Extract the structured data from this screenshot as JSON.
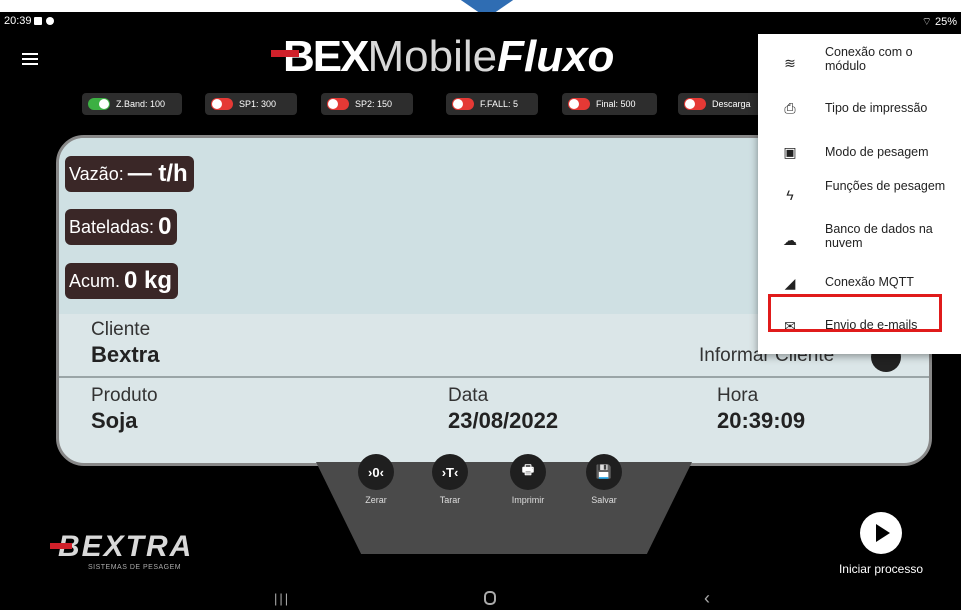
{
  "status_bar": {
    "time": "20:39",
    "battery": "25%"
  },
  "header": {
    "brand_bex": "BEX",
    "brand_mobile": "Mobile",
    "brand_fluxo": "Fluxo"
  },
  "pills": [
    {
      "label": "Z.Band: 100",
      "state": "on"
    },
    {
      "label": "SP1: 300",
      "state": "off"
    },
    {
      "label": "SP2: 150",
      "state": "off"
    },
    {
      "label": "F.FALL: 5",
      "state": "off"
    },
    {
      "label": "Final: 500",
      "state": "off"
    },
    {
      "label": "Descarga",
      "state": "off"
    }
  ],
  "stats": {
    "vazao_label": "Vazão:",
    "vazao_value": "— t/h",
    "bateladas_label": "Bateladas:",
    "bateladas_value": "0",
    "acum_label": "Acum.",
    "acum_value": "0 kg"
  },
  "info": {
    "cliente_label": "Cliente",
    "cliente_value": "Bextra",
    "informar_cliente": "Informar Cliente",
    "produto_label": "Produto",
    "produto_value": "Soja",
    "data_label": "Data",
    "data_value": "23/08/2022",
    "hora_label": "Hora",
    "hora_value": "20:39:09"
  },
  "actions": [
    {
      "icon": "zero-icon",
      "glyph": "›0‹",
      "label": "Zerar"
    },
    {
      "icon": "tare-icon",
      "glyph": "›T‹",
      "label": "Tarar"
    },
    {
      "icon": "printer-icon",
      "glyph": "🖶",
      "label": "Imprimir"
    },
    {
      "icon": "save-icon",
      "glyph": "💾",
      "label": "Salvar"
    }
  ],
  "logo": {
    "word": "BEXTRA",
    "tagline": "SISTEMAS DE PESAGEM"
  },
  "start": {
    "label": "Iniciar processo"
  },
  "menu": {
    "items": [
      {
        "icon": "wifi-icon",
        "glyph": "≋",
        "label": "Conexão com o módulo"
      },
      {
        "icon": "printer-icon",
        "glyph": "⎙",
        "label": "Tipo de impressão"
      },
      {
        "icon": "scale-icon",
        "glyph": "▣",
        "label": "Modo de pesagem"
      },
      {
        "icon": "bolt-icon",
        "glyph": "ϟ",
        "label": "Funções de pesagem"
      },
      {
        "icon": "cloud-icon",
        "glyph": "☁",
        "label": "Banco de dados na nuvem"
      },
      {
        "icon": "rss-icon",
        "glyph": "◢",
        "label": "Conexão MQTT"
      },
      {
        "icon": "mail-icon",
        "glyph": "✉",
        "label": "Envio de e-mails"
      }
    ]
  },
  "colors": {
    "highlight": "#e01b1b",
    "panel": "#dbe6e8",
    "toggle_on": "#3cb043",
    "toggle_off": "#e53935"
  }
}
